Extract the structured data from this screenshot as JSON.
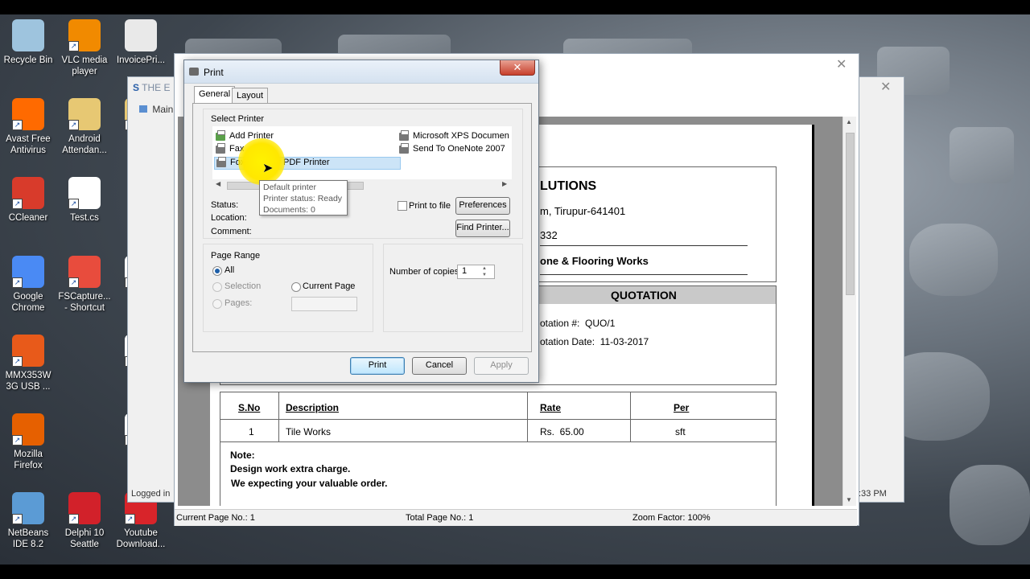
{
  "desktop": {
    "icons": [
      {
        "label": "Recycle Bin",
        "color": "#9ec4de"
      },
      {
        "label": "VLC media player",
        "color": "#f18a00"
      },
      {
        "label": "InvoicePri...",
        "color": "#e9e9e9"
      },
      {
        "label": "Avast Free Antivirus",
        "color": "#ff6a00"
      },
      {
        "label": "Android Attendan...",
        "color": "#e7c873"
      },
      {
        "label": "le",
        "color": "#e7c873"
      },
      {
        "label": "CCleaner",
        "color": "#d83b2b"
      },
      {
        "label": "Test.cs",
        "color": "#ffffff"
      },
      {
        "label": "Google Chrome",
        "color": "#4a8af4"
      },
      {
        "label": "FSCapture... - Shortcut",
        "color": "#e84c3d"
      },
      {
        "label": "qu",
        "color": "#ffffff"
      },
      {
        "label": "MMX353W 3G USB ...",
        "color": "#e85a1a"
      },
      {
        "label": "qu",
        "color": "#ffffff"
      },
      {
        "label": "Mozilla Firefox",
        "color": "#e66000"
      },
      {
        "label": "qu",
        "color": "#ffffff"
      },
      {
        "label": "NetBeans IDE 8.2",
        "color": "#5b9bd5"
      },
      {
        "label": "Delphi 10 Seattle",
        "color": "#d2212a"
      },
      {
        "label": "Youtube Download...",
        "color": "#d8242a"
      }
    ]
  },
  "back_window": {
    "title": "THE E",
    "tab": "Main",
    "status_left": "Logged in",
    "status_right": ":33 PM"
  },
  "preview": {
    "doc": {
      "company": "LUTIONS",
      "address": "m, Tirupur-641401",
      "phone": "332",
      "business": "one & Flooring Works",
      "heading": "QUOTATION",
      "quote_no_label": "otation #:",
      "quote_no": "QUO/1",
      "quote_date_label": "otation Date:",
      "quote_date": "11-03-2017",
      "table": {
        "headers": [
          "S.No",
          "Description",
          "Rate",
          "Per"
        ],
        "rows": [
          [
            "1",
            "Tile Works",
            "Rs.  65.00",
            "sft"
          ]
        ]
      },
      "note_title": "Note:",
      "note_lines": [
        "Design work extra charge.",
        "We expecting your valuable order."
      ]
    },
    "status": {
      "current_page": "Current Page No.: 1",
      "total_page": "Total Page No.: 1",
      "zoom": "Zoom Factor: 100%"
    }
  },
  "dialog": {
    "title": "Print",
    "close": "✕",
    "tabs": [
      "General",
      "Layout"
    ],
    "select_printer_label": "Select Printer",
    "printers_left": [
      "Add Printer",
      "Fax",
      "Foxit Reader PDF Printer"
    ],
    "printers_right": [
      "Microsoft XPS Documen",
      "Send To OneNote 2007"
    ],
    "selected_printer": "Foxit Reader PDF Printer",
    "status_label": "Status:",
    "location_label": "Location:",
    "comment_label": "Comment:",
    "print_to_file": "Print to file",
    "preferences": "Preferences",
    "find_printer": "Find Printer...",
    "page_range_label": "Page Range",
    "range_all": "All",
    "range_selection": "Selection",
    "range_current": "Current Page",
    "range_pages": "Pages:",
    "copies_label": "Number of copies:",
    "copies_value": "1",
    "btn_print": "Print",
    "btn_cancel": "Cancel",
    "btn_apply": "Apply",
    "tooltip": [
      "Default printer",
      "Printer status: Ready",
      "Documents: 0"
    ]
  }
}
